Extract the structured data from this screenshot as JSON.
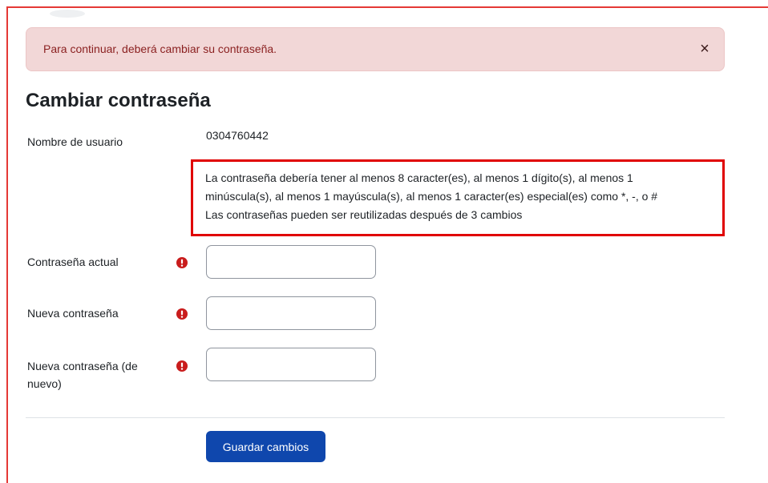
{
  "alert": {
    "message": "Para continuar, deberá cambiar su contraseña.",
    "close_symbol": "×"
  },
  "page": {
    "title": "Cambiar contraseña"
  },
  "form": {
    "username_label": "Nombre de usuario",
    "username_value": "0304760442",
    "policy_lines": [
      "La contraseña debería tener al menos 8 caracter(es), al menos 1 dígito(s), al menos 1",
      "minúscula(s), al menos 1 mayúscula(s), al menos 1 caracter(es) especial(es) como *, -, o #",
      "Las contraseñas pueden ser reutilizadas después de 3 cambios"
    ],
    "fields": [
      {
        "label": "Contraseña actual",
        "value": "",
        "required_icon": "exclamation-circle-icon"
      },
      {
        "label": "Nueva contraseña",
        "value": "",
        "required_icon": "exclamation-circle-icon"
      },
      {
        "label_line1": "Nueva contraseña (de",
        "label_line2": "nuevo)",
        "value": "",
        "required_icon": "exclamation-circle-icon"
      }
    ],
    "save_label": "Guardar cambios"
  },
  "colors": {
    "alert_bg": "#f2d7d7",
    "alert_text": "#8a1f1f",
    "highlight_border": "#e00000",
    "required_icon": "#c91c1c",
    "primary_button": "#0f47ad"
  }
}
